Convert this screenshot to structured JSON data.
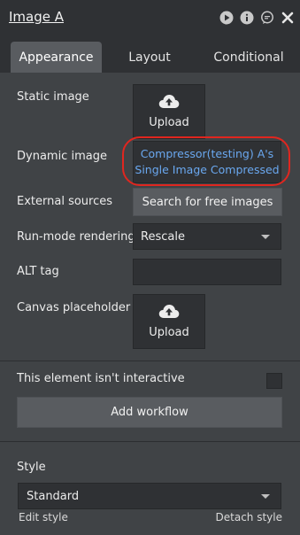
{
  "header": {
    "title": "Image A",
    "icons": [
      "play-icon",
      "info-icon",
      "comment-icon",
      "close-icon"
    ]
  },
  "tabs": [
    {
      "label": "Appearance",
      "active": true
    },
    {
      "label": "Layout",
      "active": false
    },
    {
      "label": "Conditional",
      "active": false
    }
  ],
  "fields": {
    "static_image": {
      "label": "Static image",
      "button": "Upload"
    },
    "dynamic_image": {
      "label": "Dynamic image",
      "value": "Compressor(testing) A's Single Image Compressed"
    },
    "external_sources": {
      "label": "External sources",
      "button": "Search for free images"
    },
    "run_mode": {
      "label": "Run-mode rendering",
      "value": "Rescale"
    },
    "alt_tag": {
      "label": "ALT tag",
      "value": ""
    },
    "canvas_placeholder": {
      "label": "Canvas placeholder",
      "button": "Upload"
    },
    "not_interactive": {
      "label": "This element isn't interactive",
      "checked": false
    },
    "add_workflow": {
      "label": "Add workflow"
    }
  },
  "style": {
    "label": "Style",
    "value": "Standard",
    "edit_link": "Edit style",
    "detach_link": "Detach style"
  },
  "colors": {
    "panel_bg": "#404346",
    "header_bg": "#2f3134",
    "link_blue": "#6aa8f0",
    "highlight_red": "#e0261f"
  }
}
